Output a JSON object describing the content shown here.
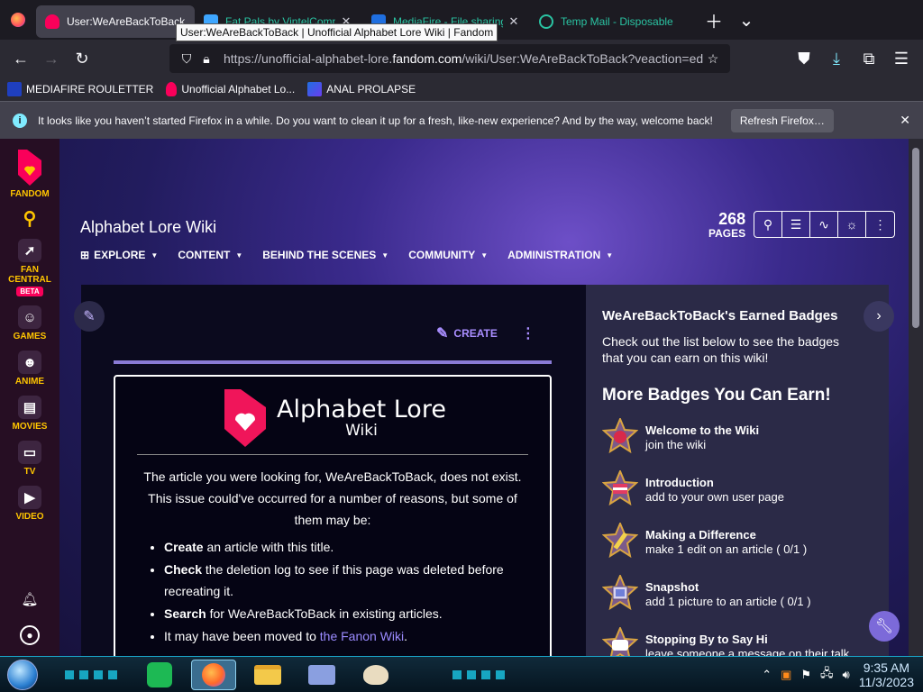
{
  "browser": {
    "tabs": [
      {
        "title": "User:WeAreBackToBack",
        "active": true
      },
      {
        "title": "Fat Pals by VintelComp",
        "active": false
      },
      {
        "title": "MediaFire - File sharing",
        "active": false
      },
      {
        "title": "Temp Mail - Disposable",
        "active": false
      }
    ],
    "tooltip": "User:WeAreBackToBack | Unofficial Alphabet Lore Wiki | Fandom",
    "url_prefix": "https://unofficial-alphabet-lore.",
    "url_host": "fandom.com",
    "url_path": "/wiki/User:WeAreBackToBack?veaction=edit",
    "bookmarks": [
      "MEDIAFIRE ROULETTER",
      "Unofficial Alphabet Lo...",
      "ANAL PROLAPSE"
    ],
    "notice_text": "It looks like you haven’t started Firefox in a while. Do you want to clean it up for a fresh, like-new experience? And by the way, welcome back!",
    "notice_button": "Refresh Firefox…"
  },
  "fandom_sidebar": {
    "logo_label": "FANDOM",
    "fan_central": "FAN CENTRAL",
    "beta": "BETA",
    "games": "GAMES",
    "anime": "ANIME",
    "movies": "MOVIES",
    "tv": "TV",
    "video": "VIDEO"
  },
  "wiki": {
    "name": "Alphabet Lore Wiki",
    "nav": [
      "EXPLORE",
      "CONTENT",
      "BEHIND THE SCENES",
      "COMMUNITY",
      "ADMINISTRATION"
    ],
    "pages_count": "268",
    "pages_label": "PAGES",
    "create_label": "CREATE",
    "logo_line1": "Alphabet Lore",
    "logo_line2": "Wiki",
    "not_exist_text": "The article you were looking for, WeAreBackToBack, does not exist. This issue could've occurred for a number of reasons, but some of them may be:",
    "list": {
      "create_bold": "Create",
      "create_rest": " an article with this title.",
      "check_bold": "Check",
      "check_rest": " the deletion log to see if this page was deleted before recreating it.",
      "search_bold": "Search",
      "search_rest": " for WeAreBackToBack in existing articles.",
      "moved_text": "It may have been moved to ",
      "moved_link": "the Fanon Wiki",
      "moved_end": "."
    }
  },
  "rail": {
    "heading": "WeAreBackToBack's Earned Badges",
    "description": "Check out the list below to see the badges that you can earn on this wiki!",
    "more_heading": "More Badges You Can Earn!",
    "badges": [
      {
        "title": "Welcome to the Wiki",
        "desc": "join the wiki"
      },
      {
        "title": "Introduction",
        "desc": "add to your own user page"
      },
      {
        "title": "Making a Difference",
        "desc": "make 1 edit on an article ( 0/1 )"
      },
      {
        "title": "Snapshot",
        "desc": "add 1 picture to an article ( 0/1 )"
      },
      {
        "title": "Stopping By to Say Hi",
        "desc": "leave someone a message on their talk"
      }
    ]
  },
  "taskbar": {
    "time": "9:35 AM",
    "date": "11/3/2023"
  }
}
